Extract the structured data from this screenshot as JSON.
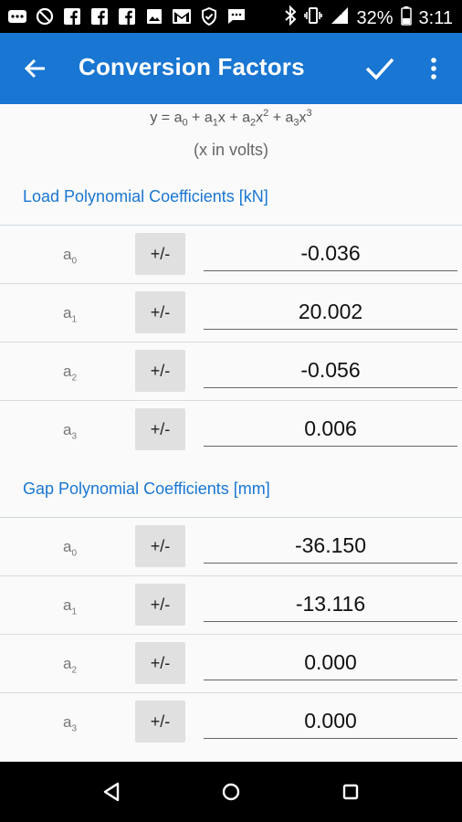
{
  "status_bar": {
    "battery_percent": "32%",
    "time": "3:11",
    "notification_icons": [
      "dots-icon",
      "blocked-icon",
      "facebook-icon",
      "facebook-icon",
      "facebook-icon",
      "image-icon",
      "gmail-icon",
      "shield-icon",
      "message-icon"
    ],
    "system_icons": [
      "bluetooth-icon",
      "vibrate-icon",
      "signal-icon",
      "battery-icon"
    ]
  },
  "app_bar": {
    "title": "Conversion Factors",
    "color": "#1976d2"
  },
  "equation": {
    "y": "y",
    "a0": "a",
    "a0_sub": "0",
    "a1": "a",
    "a1_sub": "1",
    "a2": "a",
    "a2_sub": "2",
    "a3": "a",
    "a3_sub": "3",
    "x": "x",
    "sq": "2",
    "cube": "3",
    "units_note": "(x in volts)"
  },
  "load_section": {
    "label": "Load Polynomial Coefficients [kN]",
    "rows": [
      {
        "name": "a",
        "sub": "0",
        "button": "+/-",
        "value": "-0.036"
      },
      {
        "name": "a",
        "sub": "1",
        "button": "+/-",
        "value": "20.002"
      },
      {
        "name": "a",
        "sub": "2",
        "button": "+/-",
        "value": "-0.056"
      },
      {
        "name": "a",
        "sub": "3",
        "button": "+/-",
        "value": "0.006"
      }
    ]
  },
  "gap_section": {
    "label": "Gap Polynomial Coefficients [mm]",
    "rows": [
      {
        "name": "a",
        "sub": "0",
        "button": "+/-",
        "value": "-36.150"
      },
      {
        "name": "a",
        "sub": "1",
        "button": "+/-",
        "value": "-13.116"
      },
      {
        "name": "a",
        "sub": "2",
        "button": "+/-",
        "value": "0.000"
      },
      {
        "name": "a",
        "sub": "3",
        "button": "+/-",
        "value": "0.000"
      }
    ]
  }
}
